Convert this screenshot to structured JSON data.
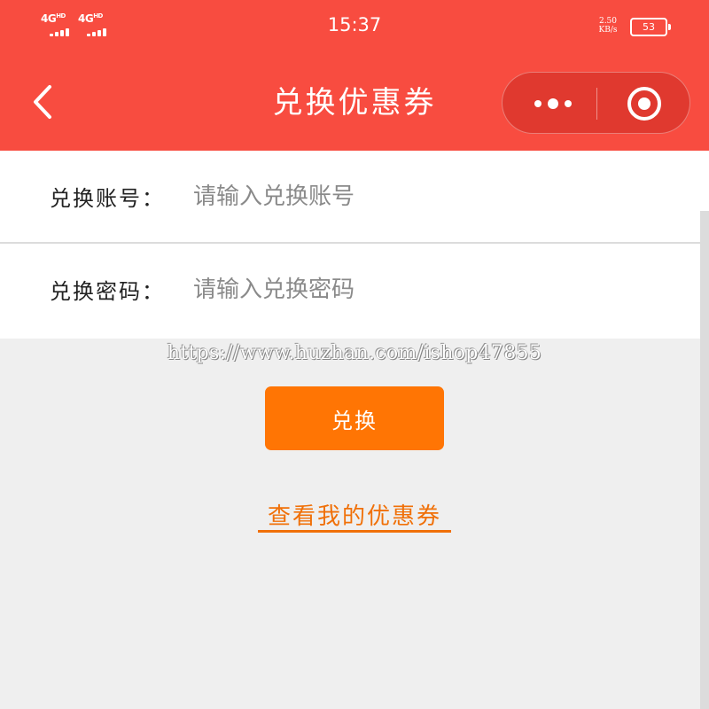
{
  "status_bar": {
    "sim1": "4G",
    "sim1_sup": "HD",
    "sim2": "4G",
    "sim2_sup": "HD",
    "time": "15:37",
    "speed_value": "2.50",
    "speed_unit": "KB/s",
    "battery": "53"
  },
  "nav": {
    "title": "兑换优惠券",
    "back_icon": "chevron-left-icon",
    "more_icon": "more-dots-icon",
    "close_icon": "target-circle-icon"
  },
  "form": {
    "account_label": "兑换账号：",
    "account_placeholder": "请输入兑换账号",
    "password_label": "兑换密码：",
    "password_placeholder": "请输入兑换密码"
  },
  "watermark": "https://www.huzhan.com/ishop47855",
  "actions": {
    "redeem_label": "兑换",
    "view_coupons_label": "查看我的优惠券"
  },
  "colors": {
    "header": "#f84c40",
    "button": "#ff7504",
    "link": "#f07008",
    "background": "#efefef"
  }
}
